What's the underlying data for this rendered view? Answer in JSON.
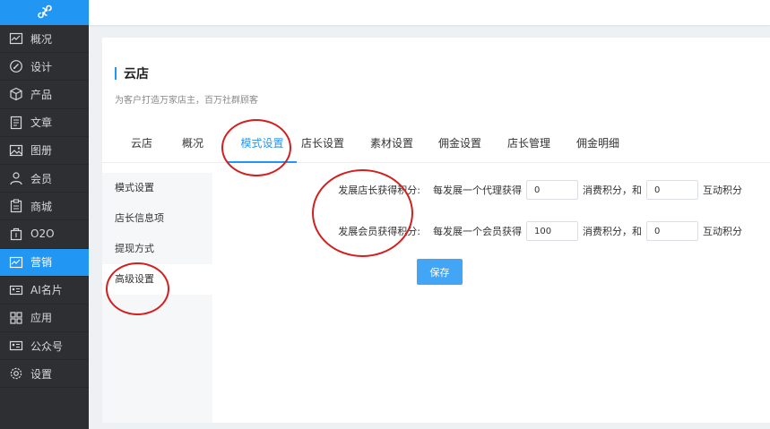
{
  "sidebar": {
    "logo_icon": "mini-program-logo-icon",
    "items": [
      {
        "label": "概况",
        "icon": "chart-icon"
      },
      {
        "label": "设计",
        "icon": "palette-icon"
      },
      {
        "label": "产品",
        "icon": "box-icon"
      },
      {
        "label": "文章",
        "icon": "document-icon"
      },
      {
        "label": "图册",
        "icon": "image-icon"
      },
      {
        "label": "会员",
        "icon": "user-icon"
      },
      {
        "label": "商城",
        "icon": "clipboard-icon"
      },
      {
        "label": "O2O",
        "icon": "store-icon"
      },
      {
        "label": "营销",
        "icon": "trend-icon",
        "active": true
      },
      {
        "label": "AI名片",
        "icon": "card-icon"
      },
      {
        "label": "应用",
        "icon": "grid-icon"
      },
      {
        "label": "公众号",
        "icon": "account-icon"
      },
      {
        "label": "设置",
        "icon": "gear-icon"
      }
    ]
  },
  "page": {
    "title": "云店",
    "subtitle": "为客户打造万家店主，百万社群顾客"
  },
  "tabs": [
    {
      "label": "云店"
    },
    {
      "label": "概况"
    },
    {
      "label": "模式设置",
      "active": true
    },
    {
      "label": "店长设置"
    },
    {
      "label": "素材设置"
    },
    {
      "label": "佣金设置"
    },
    {
      "label": "店长管理"
    },
    {
      "label": "佣金明细"
    }
  ],
  "left_menu": [
    {
      "label": "模式设置"
    },
    {
      "label": "店长信息项"
    },
    {
      "label": "提现方式"
    },
    {
      "label": "高级设置",
      "active": true
    }
  ],
  "form": {
    "row1": {
      "label": "发展店长获得积分:",
      "prefix": "每发展一个代理获得",
      "value1": "0",
      "middle": "消费积分，和",
      "value2": "0",
      "suffix": "互动积分"
    },
    "row2": {
      "label": "发展会员获得积分:",
      "prefix": "每发展一个会员获得",
      "value1": "100",
      "middle": "消费积分，和",
      "value2": "0",
      "suffix": "互动积分"
    },
    "save_label": "保存"
  },
  "colors": {
    "accent": "#2196f3",
    "sidebar_bg": "#2d2f33",
    "annotation": "#d21f1f"
  }
}
